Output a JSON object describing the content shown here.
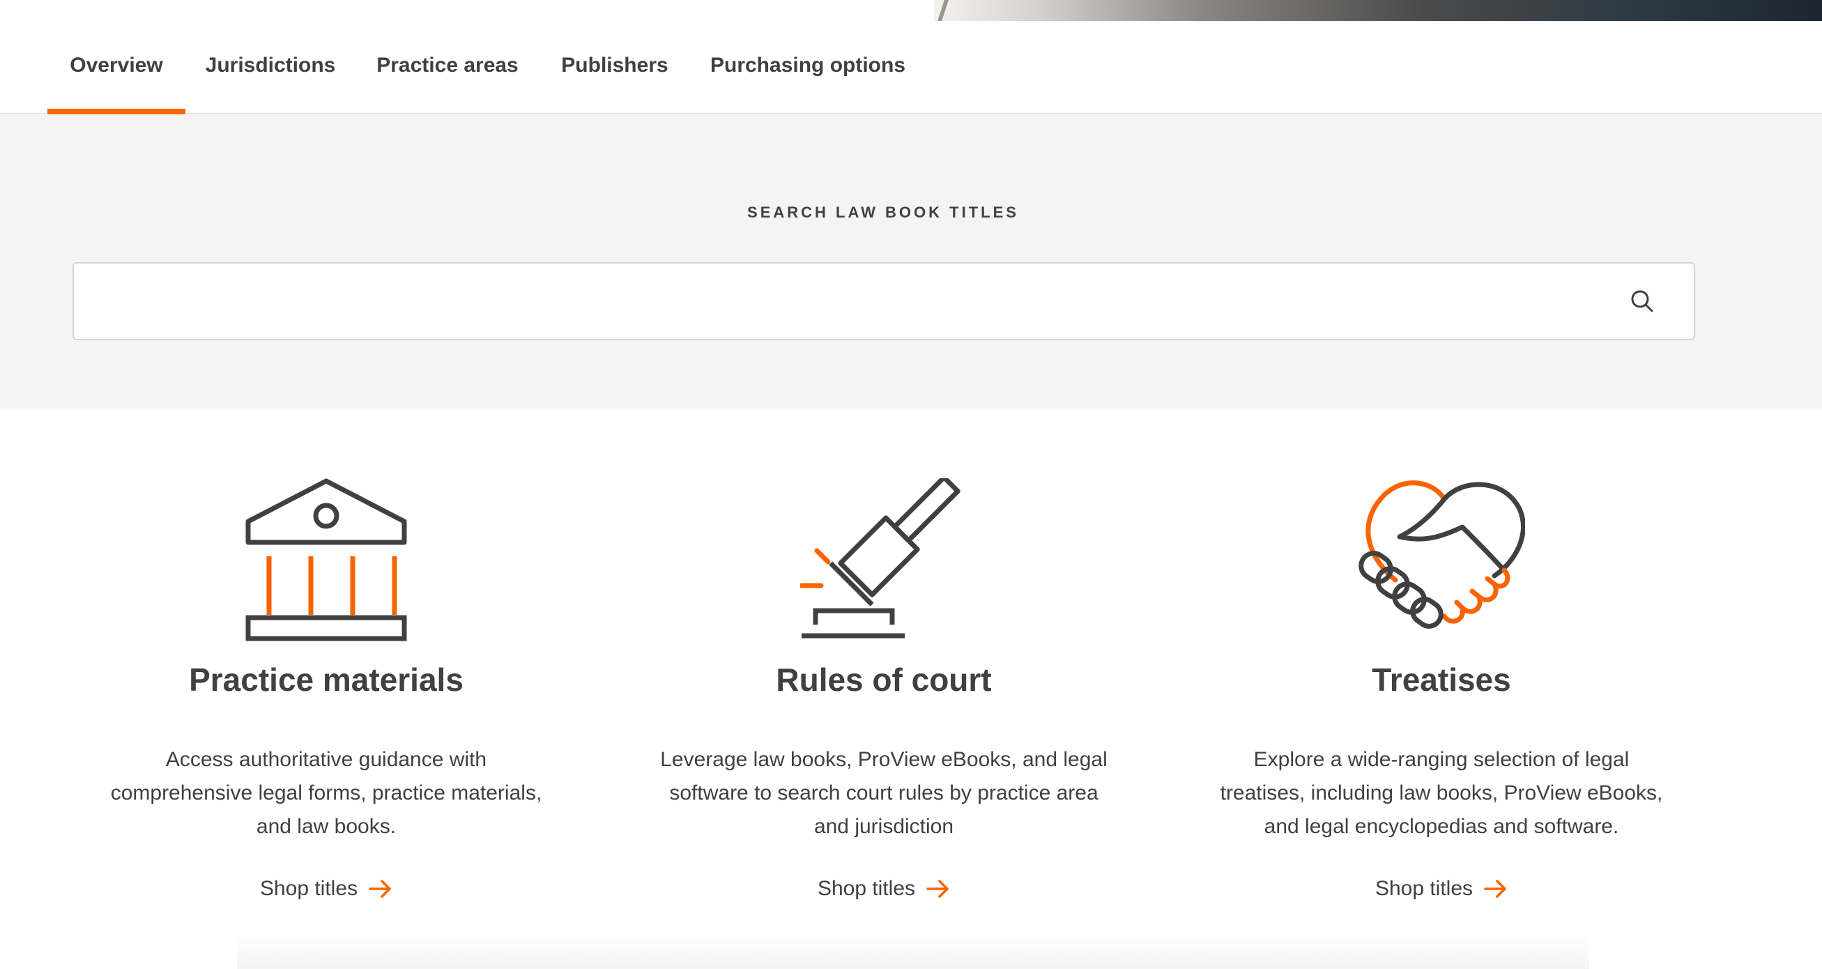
{
  "tabs": [
    {
      "label": "Overview",
      "active": true
    },
    {
      "label": "Jurisdictions",
      "active": false
    },
    {
      "label": "Practice areas",
      "active": false
    },
    {
      "label": "Publishers",
      "active": false
    },
    {
      "label": "Purchasing options",
      "active": false
    }
  ],
  "search": {
    "heading": "SEARCH LAW BOOK TITLES",
    "placeholder": "",
    "value": "",
    "icon": "search-icon"
  },
  "cards": [
    {
      "icon": "courthouse-icon",
      "title": "Practice materials",
      "description": "Access authoritative guidance with comprehensive legal forms, practice materials, and law books.",
      "link_label": "Shop titles"
    },
    {
      "icon": "gavel-icon",
      "title": "Rules of court",
      "description": "Leverage law books, ProView eBooks, and legal software to search court rules by practice area and jurisdiction",
      "link_label": "Shop titles"
    },
    {
      "icon": "handshake-icon",
      "title": "Treatises",
      "description": "Explore a wide-ranging selection of legal treatises, including law books, ProView eBooks, and legal encyclopedias and software.",
      "link_label": "Shop titles"
    }
  ],
  "colors": {
    "accent": "#fa6400",
    "text": "#404040",
    "band": "#f4f4f4"
  }
}
